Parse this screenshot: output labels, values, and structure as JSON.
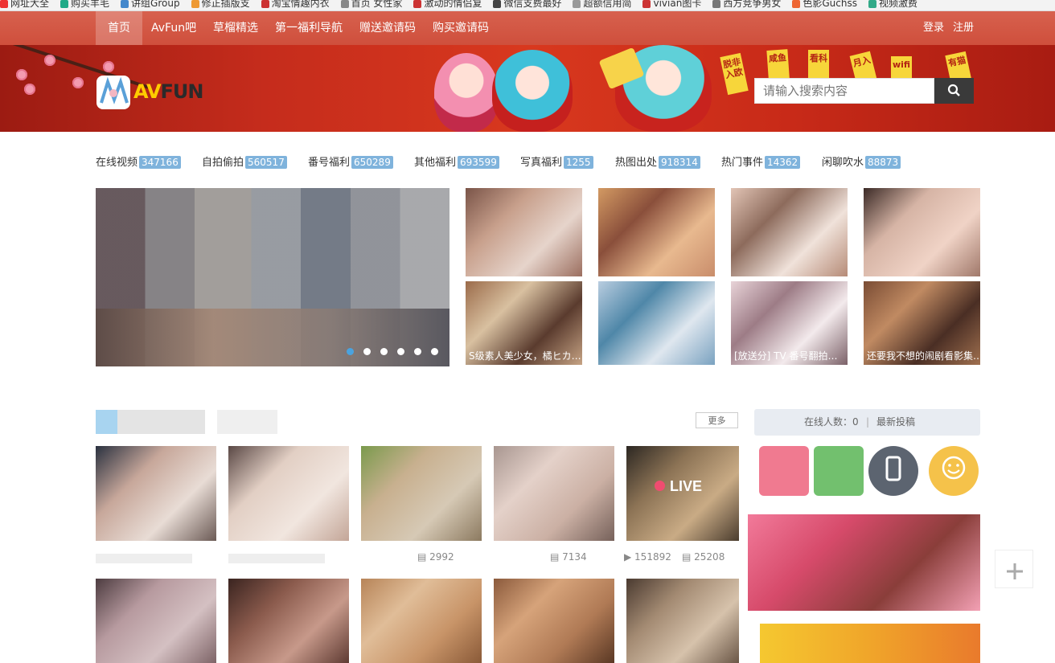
{
  "bookmarks": [
    "网址大全",
    "购买羊毛",
    "讲组Group",
    "修正插版支",
    "淘宝情趣内衣",
    "首页 女性家",
    "激动的情侣复",
    "微信支费最好",
    "超额信用简",
    "vivian图卡",
    "西方竞争男女",
    "色影Guchss",
    "视频激费"
  ],
  "nav": {
    "items": [
      "首页",
      "AvFun吧",
      "草榴精选",
      "第一福利导航",
      "赠送邀请码",
      "购买邀请码"
    ],
    "login": "登录",
    "register": "注册"
  },
  "banner": {
    "logo_text_a": "AV",
    "logo_text_b": "FUN",
    "flags": [
      "脱非入欧",
      "咸鱼",
      "看科",
      "月入",
      "wifi",
      "有猫"
    ]
  },
  "search": {
    "placeholder": "请输入搜索内容"
  },
  "categories": [
    {
      "label": "在线视频",
      "count": "347166"
    },
    {
      "label": "自拍偷拍",
      "count": "560517"
    },
    {
      "label": "番号福利",
      "count": "650289"
    },
    {
      "label": "其他福利",
      "count": "693599"
    },
    {
      "label": "写真福利",
      "count": "1255"
    },
    {
      "label": "热图出处",
      "count": "918314"
    },
    {
      "label": "热门事件",
      "count": "14362"
    },
    {
      "label": "闲聊吹水",
      "count": "88873"
    }
  ],
  "carousel": {
    "dot_count": 6
  },
  "captions": [
    "S级素人美少女，橘ヒカ…",
    "[放送分] TV 番号翻拍…",
    "还要我不想的闹剧看影集…"
  ],
  "section": {
    "more_label": "更多",
    "online_label": "在线人数：0",
    "sep": "|",
    "latest_label": "最新投稿"
  },
  "live_label": "LIVE",
  "stats": [
    "2992",
    "7134",
    "151892",
    "25208"
  ],
  "colors": {
    "nav": "#cf4f3c",
    "badge": "#7fb3dc",
    "banner": "#c52c1c"
  }
}
